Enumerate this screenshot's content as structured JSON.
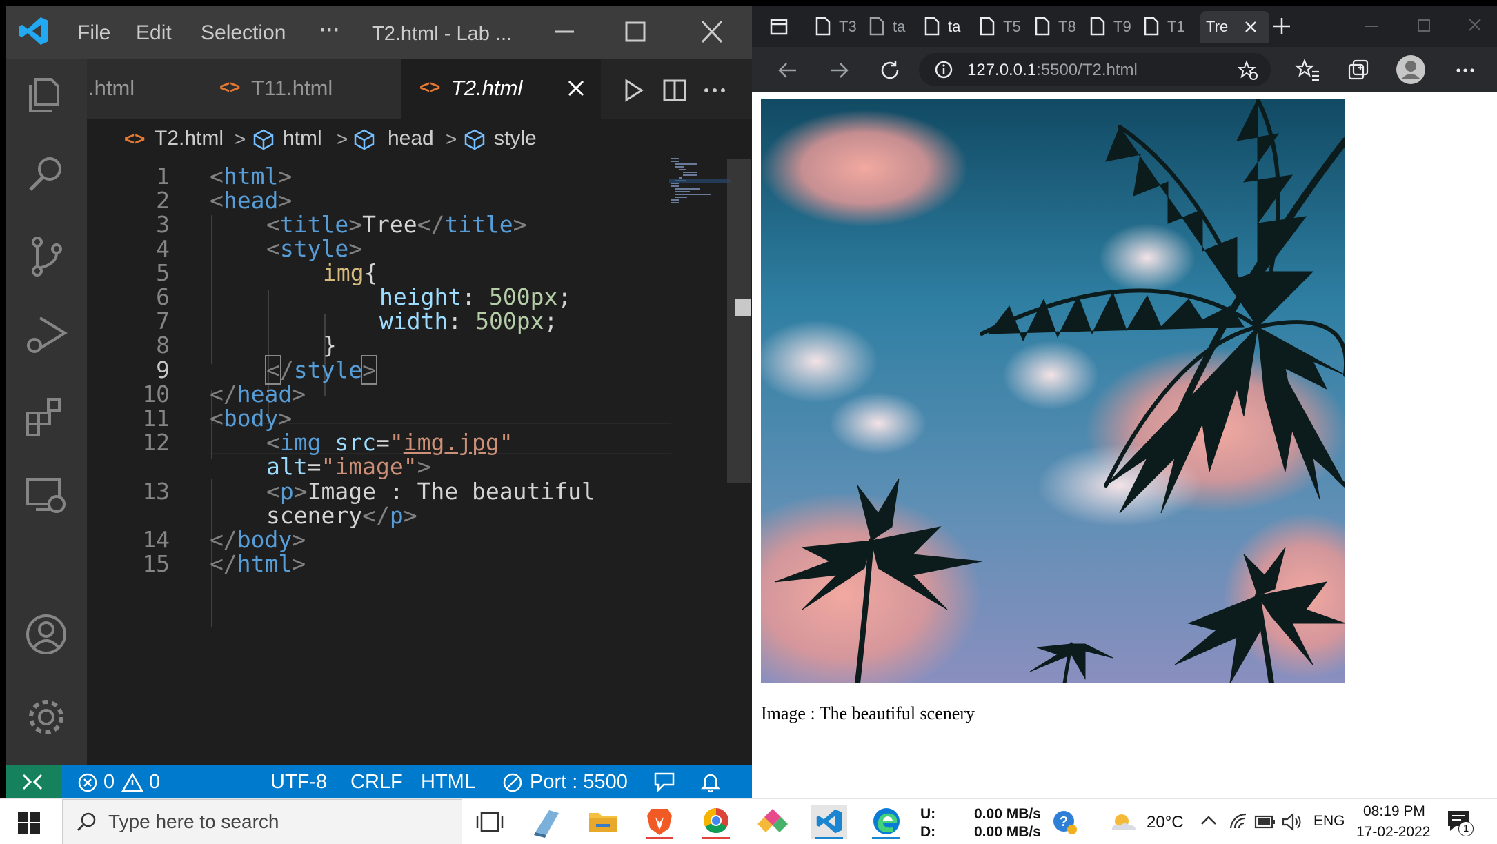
{
  "vscode": {
    "menu": [
      "File",
      "Edit",
      "Selection",
      "···"
    ],
    "window_title": "T2.html - Lab ...",
    "tabs": [
      {
        "label": ".html"
      },
      {
        "label": "T11.html"
      },
      {
        "label": "T2.html"
      }
    ],
    "breadcrumb": [
      "T2.html",
      "html",
      "head",
      "style"
    ],
    "line_numbers": [
      "1",
      "2",
      "3",
      "4",
      "5",
      "6",
      "7",
      "8",
      "9",
      "10",
      "11",
      "12",
      "13",
      "14",
      "15"
    ],
    "code": {
      "l1_tag": "html",
      "l2_tag": "head",
      "l3_tag": "title",
      "l3_text": "Tree",
      "l4_tag": "style",
      "l5_sel": "img",
      "l6_prop": "height",
      "l6_val": "500px",
      "l7_prop": "width",
      "l7_val": "500px",
      "l9_tag": "style",
      "l10_tag": "head",
      "l11_tag": "body",
      "l12_tag": "img",
      "l12_attr": "src",
      "l12_val": "img.jpg",
      "l12b_attr": "alt",
      "l12b_val": "\"image\"",
      "l13_tag": "p",
      "l13_text": "Image : The beautiful",
      "l13b_text": "scenery",
      "l14_tag": "body",
      "l15_tag": "html"
    },
    "status": {
      "errors": "0",
      "warnings": "0",
      "encoding": "UTF-8",
      "eol": "CRLF",
      "language": "HTML",
      "port": "Port : 5500"
    }
  },
  "browser": {
    "tabs": [
      "T3",
      "ta",
      "ta",
      "T5",
      "T8",
      "T9",
      "T1",
      "Tre"
    ],
    "url_host": "127.0.0.1",
    "url_rest": ":5500/T2.html",
    "caption": "Image : The beautiful scenery"
  },
  "taskbar": {
    "search_placeholder": "Type here to search",
    "net_up_label": "U:",
    "net_down_label": "D:",
    "net_up": "0.00 MB/s",
    "net_down": "0.00 MB/s",
    "temperature": "20°C",
    "language": "ENG",
    "time": "08:19 PM",
    "date": "17-02-2022",
    "notifications": "1"
  },
  "colors": {
    "status_bar": "#007acc",
    "remote_indicator": "#16825d",
    "editor_bg": "#1e1e1e",
    "html_tag": "#569cd6",
    "css_selector": "#d7ba7d",
    "css_property": "#9cdcfe",
    "css_value": "#b5cea8",
    "string": "#ce9178"
  },
  "icons": [
    "vscode-logo-icon",
    "explorer-icon",
    "search-icon",
    "source-control-icon",
    "run-debug-icon",
    "extensions-icon",
    "remote-explorer-icon",
    "account-icon",
    "settings-gear-icon",
    "close-icon",
    "run-icon",
    "split-editor-icon",
    "more-icon",
    "cube-symbol-icon",
    "back-icon",
    "forward-icon",
    "refresh-icon",
    "info-icon",
    "favorite-add-icon",
    "favorites-icon",
    "collections-icon",
    "profile-icon",
    "windows-start-icon",
    "task-view-icon",
    "file-explorer-icon",
    "brave-icon",
    "chrome-icon",
    "edge-icon",
    "weather-icon",
    "wifi-icon",
    "battery-icon",
    "volume-icon",
    "notification-icon"
  ]
}
